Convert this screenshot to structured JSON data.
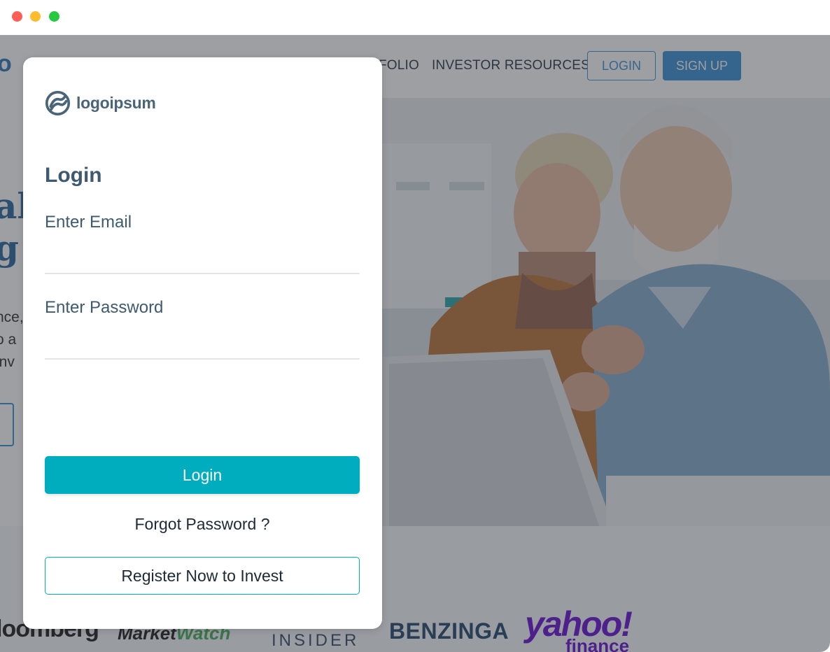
{
  "window": {
    "controls": [
      "close",
      "minimize",
      "maximize"
    ]
  },
  "site": {
    "logo_fragment": "o",
    "nav": {
      "portfolio": "FOLIO",
      "resources": "INVESTOR RESOURCES",
      "login": "LOGIN",
      "signup": "SIGN UP"
    },
    "hero": {
      "heading_line1": "al",
      "heading_line2": "g",
      "text_line1": "nce,",
      "text_line2": "o a",
      "text_line3": "inv"
    },
    "press": {
      "bloomberg": "loomberg",
      "marketwatch_a": "Market",
      "marketwatch_b": "Watch",
      "insider": "INSIDER",
      "benzinga": "BENZINGA",
      "yahoo": "yahoo!",
      "yahoo_finance": "finance"
    },
    "colors": {
      "brand_blue": "#2f8bd1",
      "teal": "#00adbf",
      "overlay": "rgba(60,64,72,0.5)"
    }
  },
  "modal": {
    "logo_text": "logoipsum",
    "title": "Login",
    "email_label": "Enter Email",
    "email_value": "",
    "password_label": "Enter Password",
    "password_value": "",
    "login_button": "Login",
    "forgot_password": "Forgot Password ?",
    "register_button": "Register Now to Invest"
  }
}
